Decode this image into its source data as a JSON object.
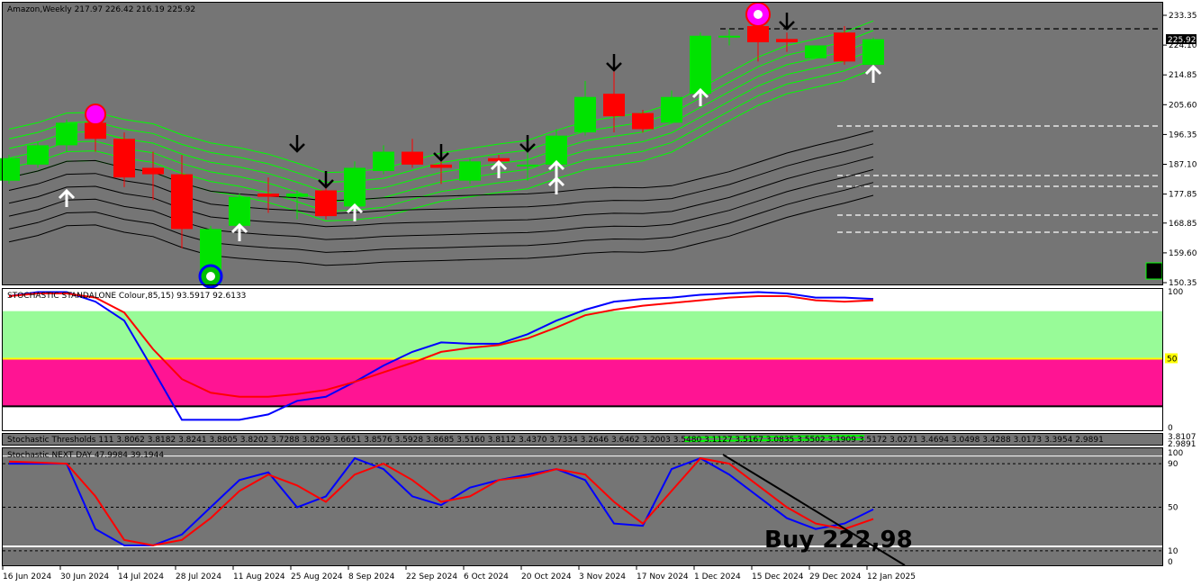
{
  "colors": {
    "chart_bg": "#757575",
    "bull": "#00e300",
    "bear": "#ff0000",
    "ma_green": "#00ff00",
    "ma_black": "#000000",
    "stoch_blue": "#0000ff",
    "stoch_red": "#ff0000",
    "zone_green": "#98fb98",
    "zone_pink": "#ff1493",
    "level_yellow": "#ffff00"
  },
  "main": {
    "header": "Amazon,Weekly  217.97 226.42 216.19 225.92",
    "price_ticks": [
      "233.35",
      "224.10",
      "214.85",
      "205.60",
      "196.35",
      "187.10",
      "177.85",
      "168.85",
      "159.60",
      "150.35"
    ],
    "current_price": "225.92"
  },
  "stoch1": {
    "header": "STOCHASTIC STANDALONE Colour,85,15) 93.5917 92.6133",
    "ticks": [
      "100",
      "50",
      "0"
    ]
  },
  "stoch_thresh": {
    "header": "Stochastic Thresholds 111  3.8062 3.8182 3.8241 3.8805 3.8202 3.7288 3.8299 3.6651 3.8576 3.5928 3.8685 3.5160 3.8112 3.4370 3.7334 3.2646 3.6462 3.2003 3.5480 3.1127 3.5167 3.0835 3.5502 3.1909 3.5172 3.0271 3.4694 3.0498 3.4288 3.0173 3.3954 2.9891",
    "ticks": [
      "3.8107",
      "2.9891"
    ]
  },
  "stoch2": {
    "header": "Stochastic NEXT DAY 47.9984 39.1944",
    "ticks": [
      "100",
      "90",
      "50",
      "10",
      "0"
    ],
    "annotation": "Buy 222,98"
  },
  "date_labels": [
    "16 Jun 2024",
    "30 Jun 2024",
    "14 Jul 2024",
    "28 Jul 2024",
    "11 Aug 2024",
    "25 Aug 2024",
    "8 Sep 2024",
    "22 Sep 2024",
    "6 Oct 2024",
    "20 Oct 2024",
    "3 Nov 2024",
    "17 Nov 2024",
    "1 Dec 2024",
    "15 Dec 2024",
    "29 Dec 2024",
    "12 Jan 2025"
  ],
  "chart_data": {
    "type": "candlestick",
    "symbol": "Amazon",
    "timeframe": "Weekly",
    "candles": [
      {
        "o": 182,
        "h": 190,
        "l": 181,
        "c": 189
      },
      {
        "o": 187,
        "h": 194,
        "l": 186,
        "c": 193
      },
      {
        "o": 193,
        "h": 201,
        "l": 191,
        "c": 200
      },
      {
        "o": 200,
        "h": 201,
        "l": 191,
        "c": 195
      },
      {
        "o": 195,
        "h": 197,
        "l": 180,
        "c": 183
      },
      {
        "o": 186,
        "h": 191,
        "l": 176,
        "c": 184
      },
      {
        "o": 184,
        "h": 190,
        "l": 161,
        "c": 167
      },
      {
        "o": 150,
        "h": 168,
        "l": 150,
        "c": 167
      },
      {
        "o": 168,
        "h": 178,
        "l": 166,
        "c": 177
      },
      {
        "o": 178,
        "h": 183,
        "l": 172,
        "c": 177
      },
      {
        "o": 177,
        "h": 179,
        "l": 170,
        "c": 178
      },
      {
        "o": 179,
        "h": 181,
        "l": 170,
        "c": 171
      },
      {
        "o": 174,
        "h": 188,
        "l": 172,
        "c": 186
      },
      {
        "o": 185,
        "h": 193,
        "l": 184,
        "c": 191
      },
      {
        "o": 191,
        "h": 195,
        "l": 186,
        "c": 187
      },
      {
        "o": 187,
        "h": 190,
        "l": 181,
        "c": 186
      },
      {
        "o": 182,
        "h": 189,
        "l": 181,
        "c": 188
      },
      {
        "o": 189,
        "h": 190,
        "l": 186,
        "c": 188
      },
      {
        "o": 187,
        "h": 192,
        "l": 182,
        "c": 187
      },
      {
        "o": 187,
        "h": 198,
        "l": 186,
        "c": 196
      },
      {
        "o": 197,
        "h": 213,
        "l": 196,
        "c": 208
      },
      {
        "o": 209,
        "h": 216,
        "l": 197,
        "c": 202
      },
      {
        "o": 203,
        "h": 204,
        "l": 197,
        "c": 198
      },
      {
        "o": 200,
        "h": 210,
        "l": 200,
        "c": 208
      },
      {
        "o": 209,
        "h": 228,
        "l": 208,
        "c": 227
      },
      {
        "o": 227,
        "h": 229,
        "l": 224,
        "c": 227
      },
      {
        "o": 230,
        "h": 233,
        "l": 219,
        "c": 225
      },
      {
        "o": 226,
        "h": 228,
        "l": 222,
        "c": 225
      },
      {
        "o": 220,
        "h": 224,
        "l": 220,
        "c": 224
      },
      {
        "o": 228,
        "h": 230,
        "l": 218,
        "c": 219
      },
      {
        "o": 217.97,
        "h": 226.42,
        "l": 216.19,
        "c": 225.92
      }
    ],
    "stochastic_standalone": {
      "blue": [
        96,
        99,
        99,
        92,
        78,
        42,
        5,
        5,
        5,
        9,
        19,
        22,
        33,
        45,
        55,
        62,
        61,
        61,
        68,
        78,
        86,
        92,
        94,
        95,
        97,
        98,
        99,
        98,
        95,
        95,
        94
      ],
      "red": [
        96,
        98,
        98,
        95,
        84,
        57,
        35,
        25,
        22,
        22,
        24,
        27,
        33,
        40,
        47,
        55,
        58,
        60,
        65,
        73,
        82,
        86,
        89,
        91,
        93,
        95,
        96,
        96,
        93,
        92,
        93
      ]
    },
    "stochastic_next_day": {
      "blue": [
        90,
        90,
        90,
        30,
        15,
        15,
        25,
        50,
        75,
        82,
        50,
        60,
        95,
        85,
        60,
        52,
        68,
        75,
        80,
        85,
        75,
        35,
        33,
        85,
        95,
        80,
        60,
        40,
        30,
        35,
        47.9984
      ],
      "red": [
        92,
        91,
        90,
        60,
        20,
        15,
        20,
        40,
        65,
        80,
        70,
        55,
        80,
        90,
        75,
        55,
        60,
        75,
        78,
        85,
        80,
        55,
        35,
        65,
        95,
        90,
        70,
        50,
        35,
        30,
        39.1944
      ]
    }
  }
}
